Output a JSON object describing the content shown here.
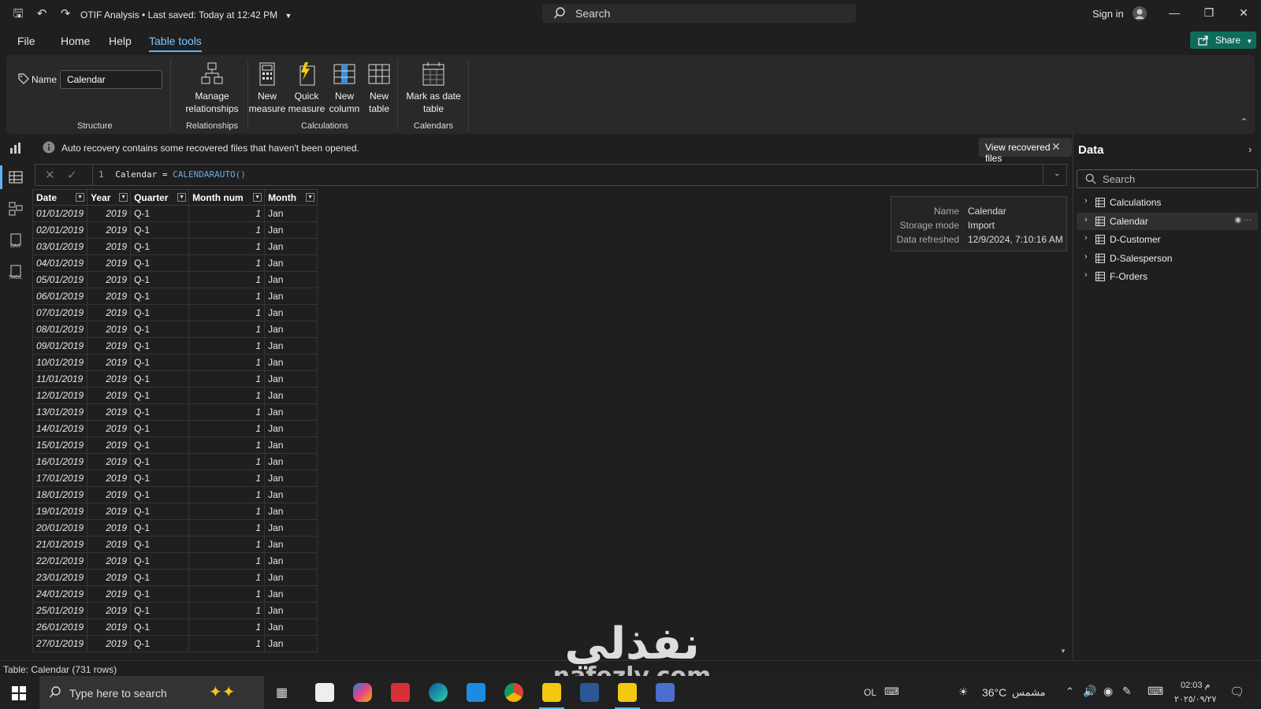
{
  "titlebar": {
    "doc_title": "OTIF Analysis",
    "last_saved": "Last saved: Today at 12:42 PM",
    "search_placeholder": "Search",
    "sign_in": "Sign in"
  },
  "menu": {
    "file": "File",
    "home": "Home",
    "help": "Help",
    "table_tools": "Table tools",
    "share": "Share"
  },
  "ribbon": {
    "name_label": "Name",
    "name_value": "Calendar",
    "structure_label": "Structure",
    "manage_rel_line1": "Manage",
    "manage_rel_line2": "relationships",
    "relationships_label": "Relationships",
    "new_measure_line1": "New",
    "new_measure_line2": "measure",
    "quick_measure_line1": "Quick",
    "quick_measure_line2": "measure",
    "new_column_line1": "New",
    "new_column_line2": "column",
    "new_table_line1": "New",
    "new_table_line2": "table",
    "calculations_label": "Calculations",
    "mark_date_line1": "Mark as date",
    "mark_date_line2": "table",
    "calendars_label": "Calendars"
  },
  "infobar": {
    "message": "Auto recovery contains some recovered files that haven't been opened.",
    "view_recovered": "View recovered files"
  },
  "formula": {
    "line_no": "1",
    "name": "Calendar",
    "eq": " = ",
    "func": "CALENDARAUTO()"
  },
  "grid": {
    "headers": [
      "Date",
      "Year",
      "Quarter",
      "Month num",
      "Month"
    ],
    "rows": [
      [
        "01/01/2019",
        "2019",
        "Q-1",
        "1",
        "Jan"
      ],
      [
        "02/01/2019",
        "2019",
        "Q-1",
        "1",
        "Jan"
      ],
      [
        "03/01/2019",
        "2019",
        "Q-1",
        "1",
        "Jan"
      ],
      [
        "04/01/2019",
        "2019",
        "Q-1",
        "1",
        "Jan"
      ],
      [
        "05/01/2019",
        "2019",
        "Q-1",
        "1",
        "Jan"
      ],
      [
        "06/01/2019",
        "2019",
        "Q-1",
        "1",
        "Jan"
      ],
      [
        "07/01/2019",
        "2019",
        "Q-1",
        "1",
        "Jan"
      ],
      [
        "08/01/2019",
        "2019",
        "Q-1",
        "1",
        "Jan"
      ],
      [
        "09/01/2019",
        "2019",
        "Q-1",
        "1",
        "Jan"
      ],
      [
        "10/01/2019",
        "2019",
        "Q-1",
        "1",
        "Jan"
      ],
      [
        "11/01/2019",
        "2019",
        "Q-1",
        "1",
        "Jan"
      ],
      [
        "12/01/2019",
        "2019",
        "Q-1",
        "1",
        "Jan"
      ],
      [
        "13/01/2019",
        "2019",
        "Q-1",
        "1",
        "Jan"
      ],
      [
        "14/01/2019",
        "2019",
        "Q-1",
        "1",
        "Jan"
      ],
      [
        "15/01/2019",
        "2019",
        "Q-1",
        "1",
        "Jan"
      ],
      [
        "16/01/2019",
        "2019",
        "Q-1",
        "1",
        "Jan"
      ],
      [
        "17/01/2019",
        "2019",
        "Q-1",
        "1",
        "Jan"
      ],
      [
        "18/01/2019",
        "2019",
        "Q-1",
        "1",
        "Jan"
      ],
      [
        "19/01/2019",
        "2019",
        "Q-1",
        "1",
        "Jan"
      ],
      [
        "20/01/2019",
        "2019",
        "Q-1",
        "1",
        "Jan"
      ],
      [
        "21/01/2019",
        "2019",
        "Q-1",
        "1",
        "Jan"
      ],
      [
        "22/01/2019",
        "2019",
        "Q-1",
        "1",
        "Jan"
      ],
      [
        "23/01/2019",
        "2019",
        "Q-1",
        "1",
        "Jan"
      ],
      [
        "24/01/2019",
        "2019",
        "Q-1",
        "1",
        "Jan"
      ],
      [
        "25/01/2019",
        "2019",
        "Q-1",
        "1",
        "Jan"
      ],
      [
        "26/01/2019",
        "2019",
        "Q-1",
        "1",
        "Jan"
      ],
      [
        "27/01/2019",
        "2019",
        "Q-1",
        "1",
        "Jan"
      ]
    ]
  },
  "tooltip": {
    "name_key": "Name",
    "name_val": "Calendar",
    "storage_key": "Storage mode",
    "storage_val": "Import",
    "refreshed_key": "Data refreshed",
    "refreshed_val": "12/9/2024, 7:10:16 AM"
  },
  "datapane": {
    "title": "Data",
    "search_placeholder": "Search",
    "tables": [
      "Calculations",
      "Calendar",
      "D-Customer",
      "D-Salesperson",
      "F-Orders"
    ]
  },
  "statusbar": {
    "text": "Table: Calendar (731 rows)"
  },
  "taskbar": {
    "search_placeholder": "Type here to search",
    "ime": "OL",
    "weather": "36°C",
    "weather_desc": "مشمس",
    "time": "02:03 م",
    "date": "٢٠٢٥/٠٩/٢٧"
  },
  "watermark": {
    "arabic": "نفذلي",
    "latin": "nafezly.com"
  },
  "colors": {
    "accent": "#5fb3f5",
    "share_button": "#0f6b5a",
    "background": "#1f1f1f",
    "ribbon": "#292929"
  },
  "icons": {
    "save": "save-icon",
    "undo": "undo-icon",
    "redo": "redo-icon",
    "search": "search-icon",
    "info": "info-icon",
    "table": "table-icon"
  }
}
